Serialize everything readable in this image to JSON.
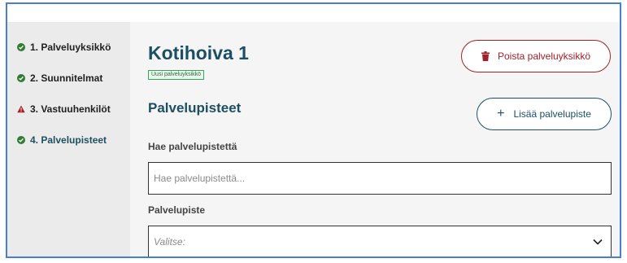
{
  "sidebar": {
    "steps": [
      {
        "label": "1. Palveluyksikkö",
        "status_icon": "check-circle-icon"
      },
      {
        "label": "2. Suunnitelmat",
        "status_icon": "check-circle-icon"
      },
      {
        "label": "3. Vastuuhenkilöt",
        "status_icon": "warning-triangle-icon"
      },
      {
        "label": "4. Palvelupisteet",
        "status_icon": "check-circle-icon",
        "active": true
      }
    ]
  },
  "main": {
    "title": "Kotihoiva 1",
    "badge": "Uusi palveluyksikkö",
    "delete_button": "Poista palveluyksikkö",
    "section_title": "Palvelupisteet",
    "add_button": "Lisää palvelupiste",
    "search": {
      "label": "Hae palvelupistettä",
      "placeholder": "Hae palvelupistettä..."
    },
    "select": {
      "label": "Palvelupiste",
      "placeholder": "Valitse:"
    }
  },
  "colors": {
    "primary": "#1d4f63",
    "danger": "#a0212a",
    "success": "#2e7d32",
    "sidebar_bg": "#ebebeb",
    "content_bg": "#f5f5f5"
  }
}
